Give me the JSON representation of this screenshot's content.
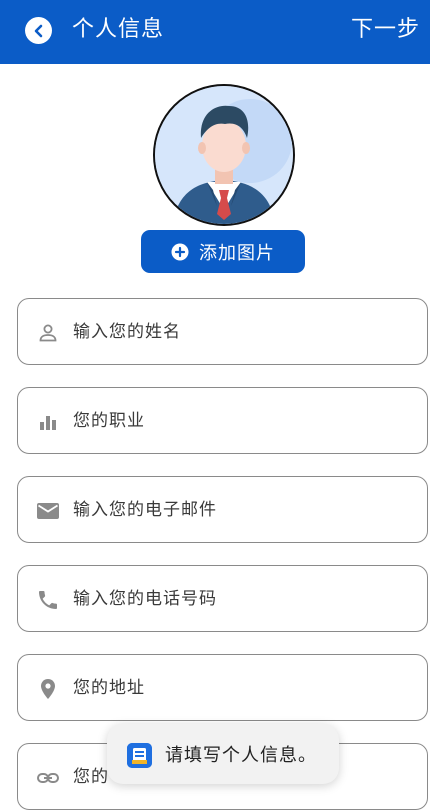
{
  "header": {
    "title": "个人信息",
    "next_label": "下一步",
    "background": "#0b5cc7"
  },
  "profile": {
    "add_photo_label": "添加图片"
  },
  "fields": [
    {
      "icon": "person-icon",
      "placeholder": "输入您的姓名"
    },
    {
      "icon": "bar-chart-icon",
      "placeholder": "您的职业"
    },
    {
      "icon": "mail-icon",
      "placeholder": "输入您的电子邮件"
    },
    {
      "icon": "phone-icon",
      "placeholder": "输入您的电话号码"
    },
    {
      "icon": "location-pin-icon",
      "placeholder": "您的地址"
    },
    {
      "icon": "link-icon",
      "placeholder": "您的"
    }
  ],
  "toast": {
    "message": "请填写个人信息。"
  }
}
